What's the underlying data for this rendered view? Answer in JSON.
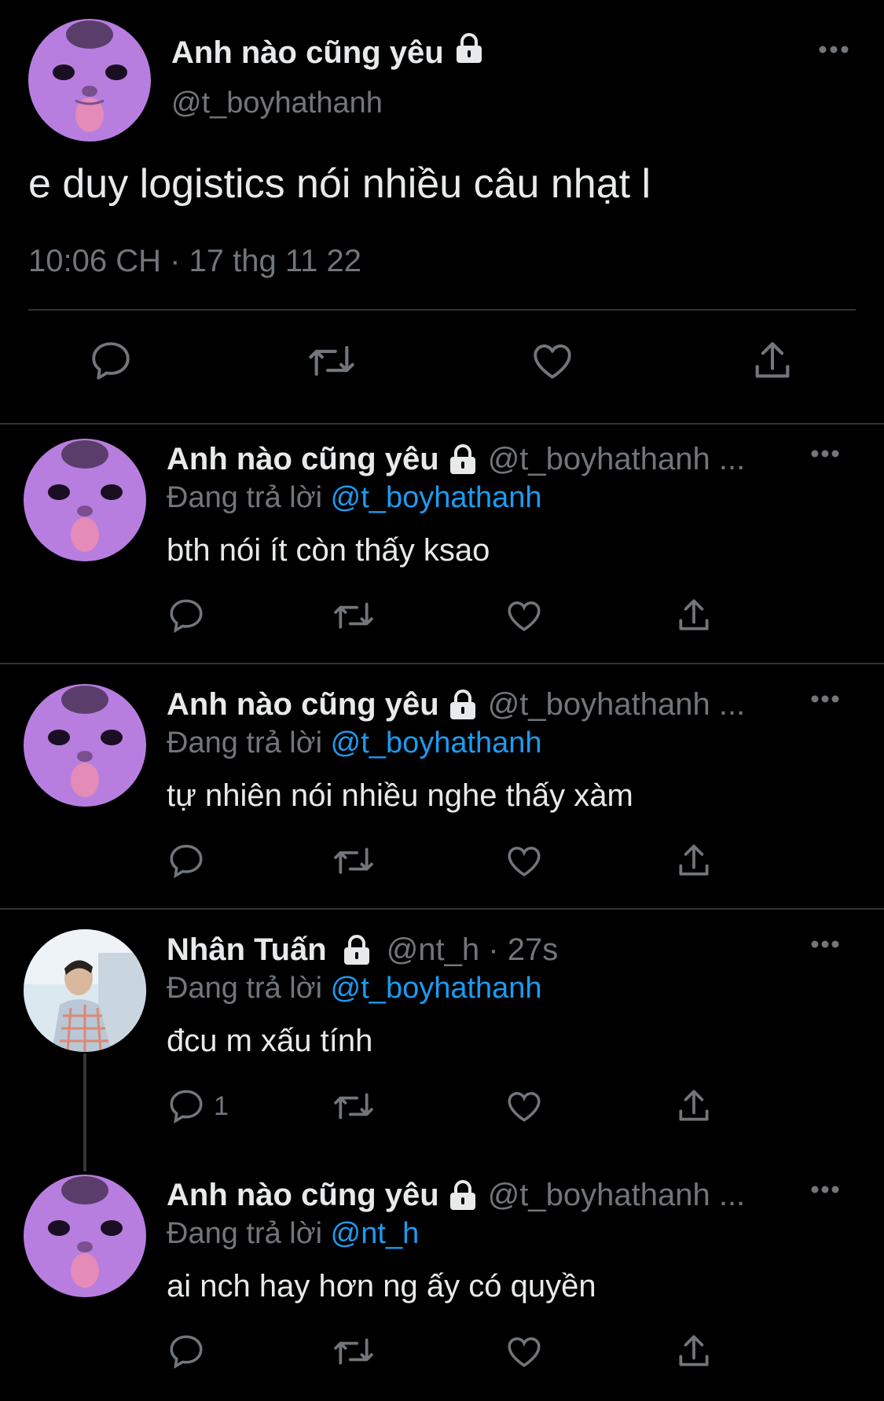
{
  "main_tweet": {
    "name": "Anh nào cũng yêu",
    "handle": "@t_boyhathanh",
    "text": "e duy logistics nói nhiều câu nhạt l",
    "timestamp": "10:06 CH · 17 thg 11 22",
    "icons": [
      "lock-icon",
      "more-icon",
      "reply-icon",
      "retweet-icon",
      "like-icon",
      "share-icon"
    ]
  },
  "replies": [
    {
      "name": "Anh nào cũng yêu",
      "handle": "@t_boyhathanh ...",
      "replying_prefix": "Đang trả lời",
      "replying_to": "@t_boyhathanh",
      "text": "bth nói ít còn thấy ksao",
      "reply_count": ""
    },
    {
      "name": "Anh nào cũng yêu",
      "handle": "@t_boyhathanh ...",
      "replying_prefix": "Đang trả lời",
      "replying_to": "@t_boyhathanh",
      "text": "tự nhiên nói nhiều nghe thấy xàm",
      "reply_count": ""
    },
    {
      "name": "Nhân Tuấn",
      "handle": "@nt_h · 27s",
      "replying_prefix": "Đang trả lời",
      "replying_to": "@t_boyhathanh",
      "text": "đcu m xấu tính",
      "reply_count": "1"
    },
    {
      "name": "Anh nào cũng yêu",
      "handle": "@t_boyhathanh ...",
      "replying_prefix": "Đang trả lời",
      "replying_to": "@nt_h",
      "text": "ai nch hay hơn ng ấy có quyền",
      "reply_count": ""
    }
  ],
  "colors": {
    "background": "#000000",
    "text": "#e7e9ea",
    "muted": "#71767b",
    "link": "#1d9bf0",
    "avatar_cat": "#b77ee0"
  }
}
